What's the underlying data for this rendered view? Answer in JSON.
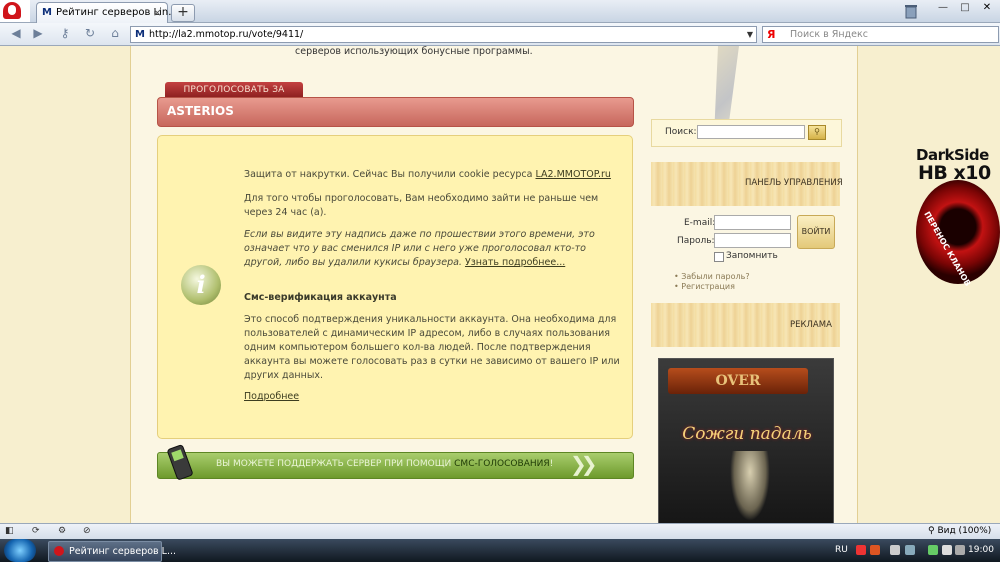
{
  "browser": {
    "tab_title": "Рейтинг серверов Lin...",
    "tab_close": "×",
    "new_tab": "+",
    "tab_favicon": "M",
    "url": "http://la2.mmotop.ru/vote/9411/",
    "search_placeholder": "Поиск в Яндекс",
    "search_engine_glyph": "Я",
    "window_min": "—",
    "window_max": "□",
    "window_close": "✕"
  },
  "page": {
    "top_note": "серверов использующих бонусные программы.",
    "vote_tab": "ПРОГОЛОСОВАТЬ ЗА СЕРВЕР",
    "server_name": "ASTERIOS",
    "info": {
      "icon_glyph": "i",
      "p1_text": "Защита от накрутки. Сейчас Вы получили cookie ресурса ",
      "p1_link": "LA2.MMOTOP.ru",
      "p2": "Для того чтобы проголосовать, Вам необходимо зайти не раньше чем через 24 час (а).",
      "p3_text": "Если вы видите эту надпись даже по прошествии этого времени, это означает что у вас сменился IP или с него уже проголосовал кто-то другой, либо вы удалили кукисы браузера. ",
      "p3_link": "Узнать подробнее...",
      "sms_heading": "Смс-верификация аккаунта",
      "p4": "Это способ подтверждения уникальности аккаунта. Она необходима для пользователей с динамическим IP адресом, либо в случаях пользования одним компьютером большего кол-ва людей. После подтверждения аккаунта вы можете голосовать раз в сутки не зависимо от вашего IP или других данных.",
      "more_link": "Подробнее"
    },
    "sms_bar": {
      "text": "ВЫ МОЖЕТЕ ПОДДЕРЖАТЬ СЕРВЕР ПРИ ПОМОЩИ ",
      "highlight": "СМС-ГОЛОСОВАНИЯ",
      "tail": "!"
    }
  },
  "sidebar": {
    "search_label": "Поиск:",
    "panel_title": "ПАНЕЛЬ УПРАВЛЕНИЯ",
    "email_label": "E-mail:",
    "password_label": "Пароль:",
    "login_button": "ВОЙТИ",
    "remember_label": "Запомнить",
    "forgot_link": "Забыли пароль?",
    "register_link": "Регистрация",
    "ads_title": "РЕКЛАМА",
    "ad_logo": "OVER",
    "ad_title": "Сожги падаль"
  },
  "side_ad": {
    "title1": "DarkSide",
    "title2": "HB x10",
    "subtitle": "ПЕРЕНОС КЛАНОВ"
  },
  "statusbar": {
    "zoom": "Вид (100%)"
  },
  "taskbar": {
    "task_title": "Рейтинг серверов L...",
    "language": "RU",
    "clock": "19:00"
  },
  "colors": {
    "accent_red": "#c7675c",
    "sms_green": "#6d9a2c",
    "info_bg": "#fff3b0"
  }
}
